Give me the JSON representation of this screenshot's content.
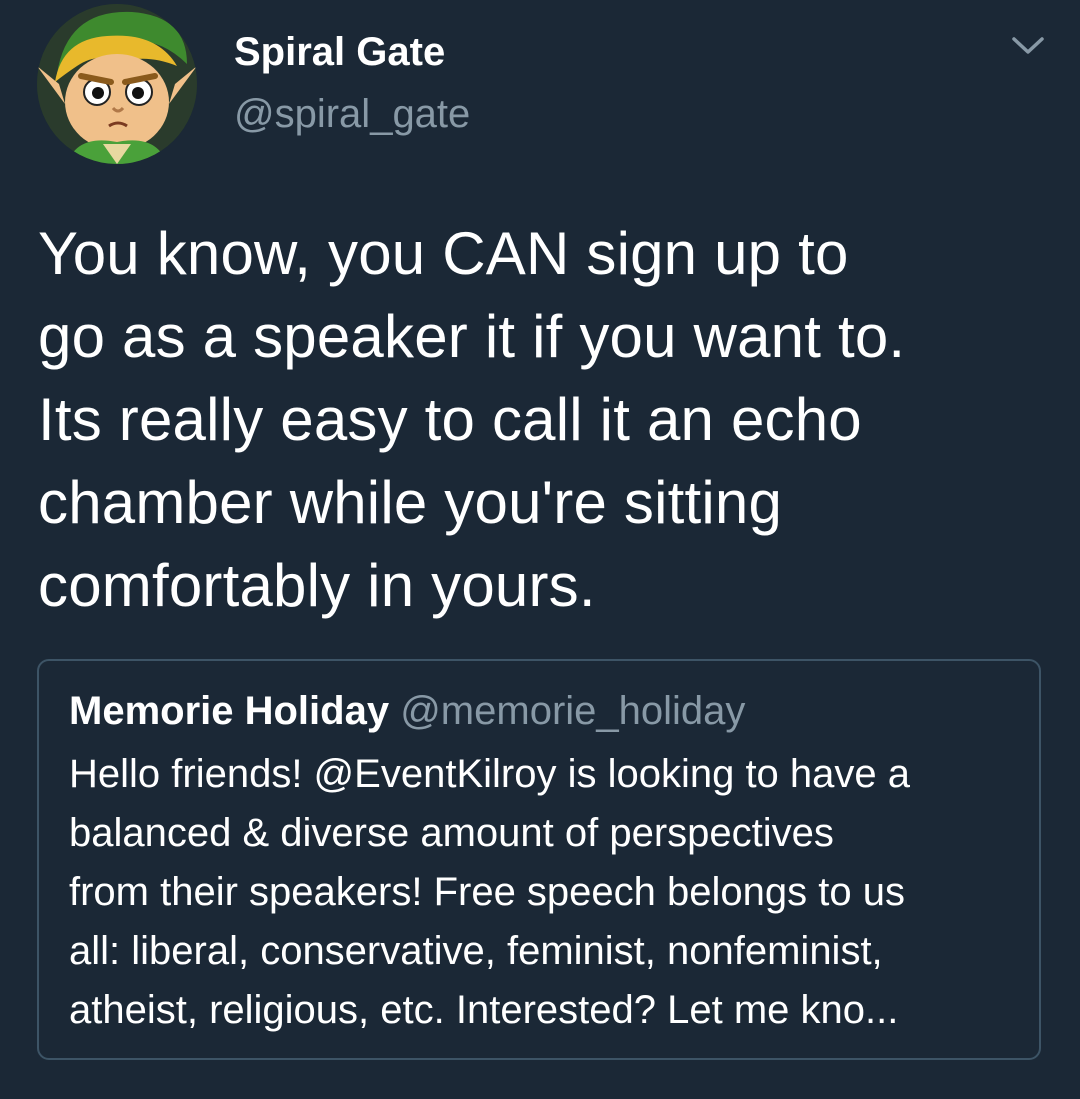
{
  "author": {
    "display_name": "Spiral Gate",
    "handle": "@spiral_gate",
    "avatar_icon": "cartoon-character-avatar"
  },
  "menu": {
    "icon": "chevron-down-icon"
  },
  "tweet": {
    "lines": [
      "You know, you CAN sign up to",
      "go as a speaker it if you want to.",
      "Its really easy to call it an echo",
      "chamber while you're sitting",
      "comfortably in yours."
    ]
  },
  "quoted_tweet": {
    "display_name": "Memorie Holiday",
    "handle": "@memorie_holiday",
    "lines": [
      "Hello friends! @EventKilroy is looking to have a",
      "balanced & diverse amount of perspectives",
      "from their speakers! Free speech belongs to us",
      "all: liberal, conservative, feminist, nonfeminist,",
      "atheist, religious, etc. Interested? Let me kno..."
    ]
  },
  "colors": {
    "background": "#1b2836",
    "primary_text": "#ffffff",
    "secondary_text": "#8899a6",
    "card_border": "#3d5466"
  }
}
